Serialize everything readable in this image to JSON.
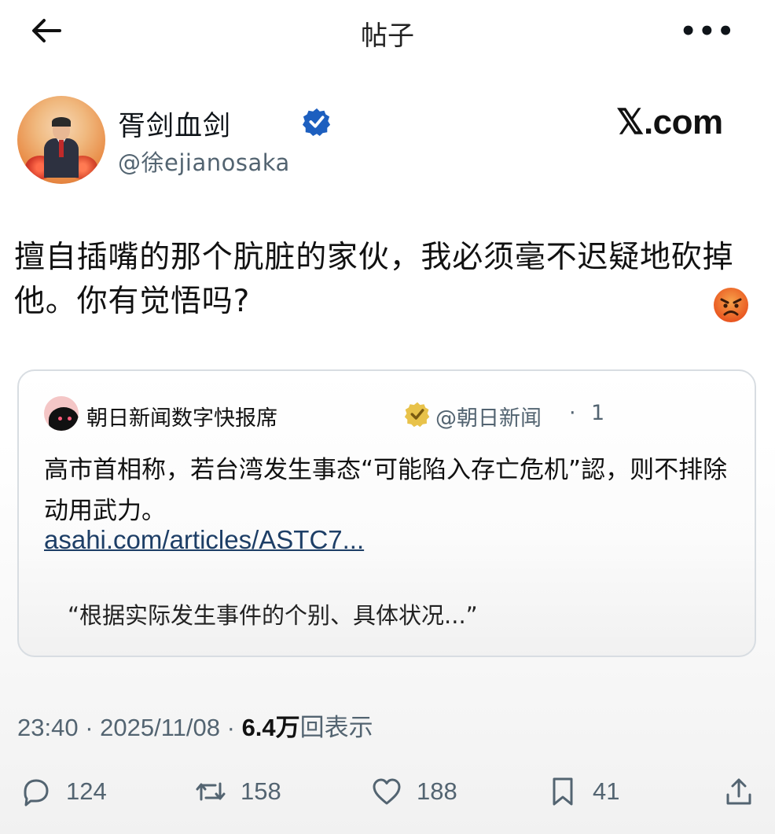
{
  "topbar": {
    "title": "帖子",
    "more": "•••"
  },
  "author": {
    "name": "胥剑血剑",
    "handle": "@徐ejianosaka",
    "source": "𝕏.com"
  },
  "tweet": {
    "text": "擅自插嘴的那个肮脏的家伙，我必须毫不迟疑地砍掉他。你有觉悟吗?"
  },
  "quote": {
    "name": "朝日新闻数字快报席",
    "handle": "@朝日新闻",
    "dot": "·",
    "time": "1",
    "text": "高市首相称，若台湾发生事态“可能陷入存亡危机”認，则不排除动用武力。",
    "link": "asahi.com/articles/ASTC7...",
    "excerpt": "“根据实际发生事件的个别、具体状况...”"
  },
  "meta": {
    "time": "23:40",
    "sep1": " · ",
    "date": "2025/11/08",
    "sep2": " · ",
    "views": "6.4万",
    "views_label": "回表示"
  },
  "actions": {
    "replies": "124",
    "reposts": "158",
    "likes": "188",
    "bookmarks": "41"
  },
  "colors": {
    "verified_blue": "#1d5fbf",
    "quote_badge_gold": "#e8c24a",
    "angry_emoji": "#f27a2c",
    "link": "#1d3e66"
  }
}
